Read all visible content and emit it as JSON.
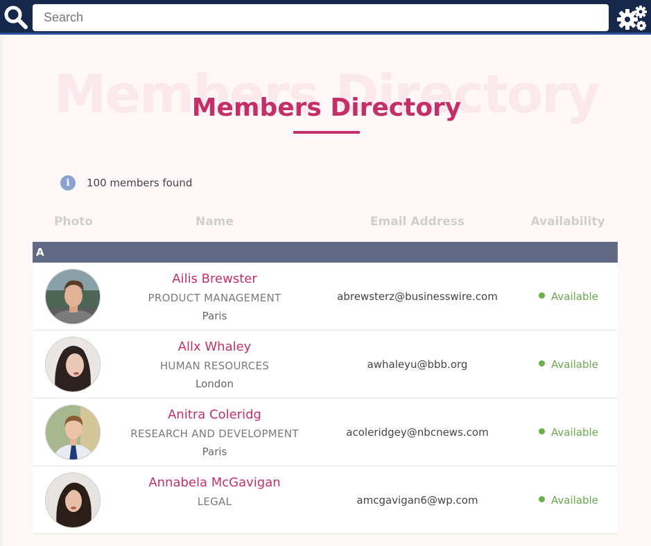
{
  "search": {
    "placeholder": "Search"
  },
  "icons": {
    "search": "search-icon",
    "settings": "gears-icon",
    "info": "info-circle-icon",
    "status": "dot-icon"
  },
  "colors": {
    "topbar": "#17284d",
    "accent": "#c33067",
    "group_header": "#606a84",
    "available": "#6aa84f"
  },
  "page": {
    "title": "Members Directory",
    "bg_title": "Members Directory",
    "count_text": "100 members found"
  },
  "table": {
    "headers": {
      "photo": "Photo",
      "name": "Name",
      "email": "Email Address",
      "availability": "Availability"
    },
    "group": "A",
    "members": [
      {
        "name": "Ailis Brewster",
        "department": "PRODUCT MANAGEMENT",
        "city": "Paris",
        "email": "abrewsterz@businesswire.com",
        "availability": "Available"
      },
      {
        "name": "Allx Whaley",
        "department": "HUMAN RESOURCES",
        "city": "London",
        "email": "awhaleyu@bbb.org",
        "availability": "Available"
      },
      {
        "name": "Anitra Coleridg",
        "department": "RESEARCH AND DEVELOPMENT",
        "city": "Paris",
        "email": "acoleridgey@nbcnews.com",
        "availability": "Available"
      },
      {
        "name": "Annabela McGavigan",
        "department": "LEGAL",
        "city": "",
        "email": "amcgavigan6@wp.com",
        "availability": "Available"
      }
    ]
  }
}
